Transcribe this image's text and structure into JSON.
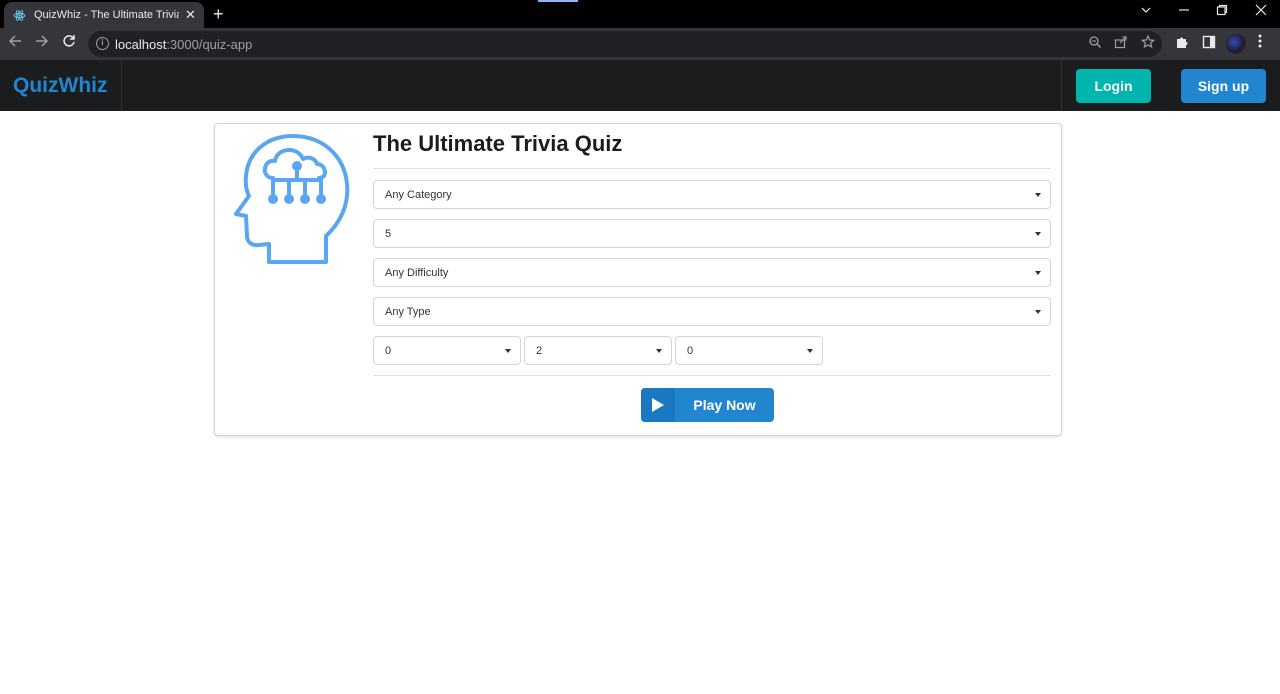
{
  "browser": {
    "tab_title": "QuizWhiz - The Ultimate Trivia Qu",
    "url_host": "localhost",
    "url_path": ":3000/quiz-app",
    "new_tab_glyph": "+",
    "close_glyph": "✕"
  },
  "navbar": {
    "brand": "QuizWhiz",
    "login_label": "Login",
    "signup_label": "Sign up"
  },
  "quiz": {
    "title": "The Ultimate Trivia Quiz",
    "category": "Any Category",
    "num_questions": "5",
    "difficulty": "Any Difficulty",
    "type": "Any Type",
    "countdown_hours": "0",
    "countdown_minutes": "2",
    "countdown_seconds": "0",
    "play_label": "Play Now"
  },
  "colors": {
    "brand": "#2185d0",
    "login": "#00b5ad",
    "icon": "#5aa6f0"
  },
  "icons": [
    "react-favicon",
    "brain-network-icon",
    "play-icon",
    "caret-down-icon"
  ]
}
